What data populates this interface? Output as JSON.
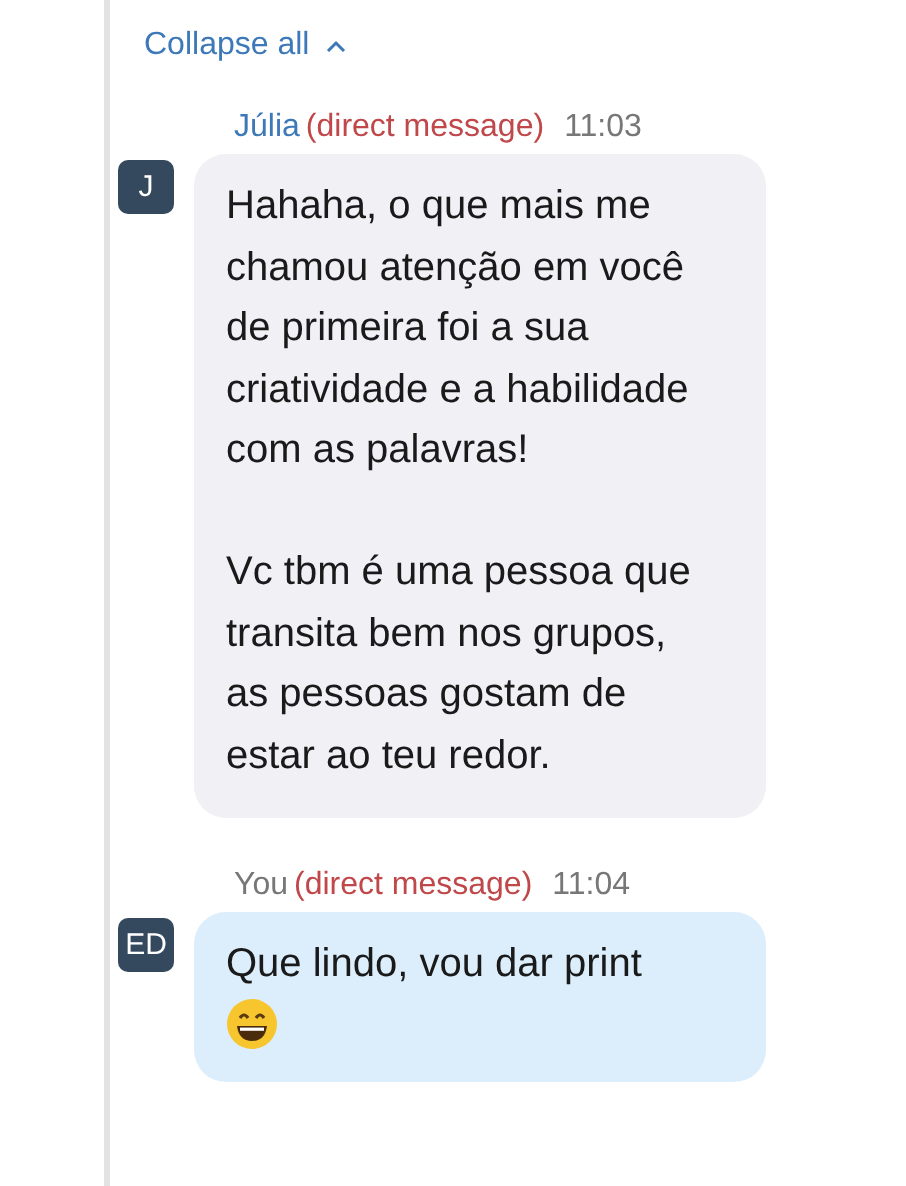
{
  "collapse": {
    "label": "Collapse all",
    "expanded": true
  },
  "messages": [
    {
      "kind": "received",
      "sender": "Júlia",
      "tag": "(direct message)",
      "time": "11:03",
      "initials": "J",
      "text": "Hahaha, o que mais me chamou atenção em você de primeira foi a sua criatividade e a habilidade com as palavras!\n\nVc tbm é uma pessoa que transita bem nos grupos, as pessoas gostam de estar ao teu redor.",
      "emoji": false
    },
    {
      "kind": "sent",
      "sender": "You",
      "tag": "(direct message)",
      "time": "11:04",
      "initials": "ED",
      "text": "Que lindo, vou dar print",
      "emoji": true
    }
  ]
}
